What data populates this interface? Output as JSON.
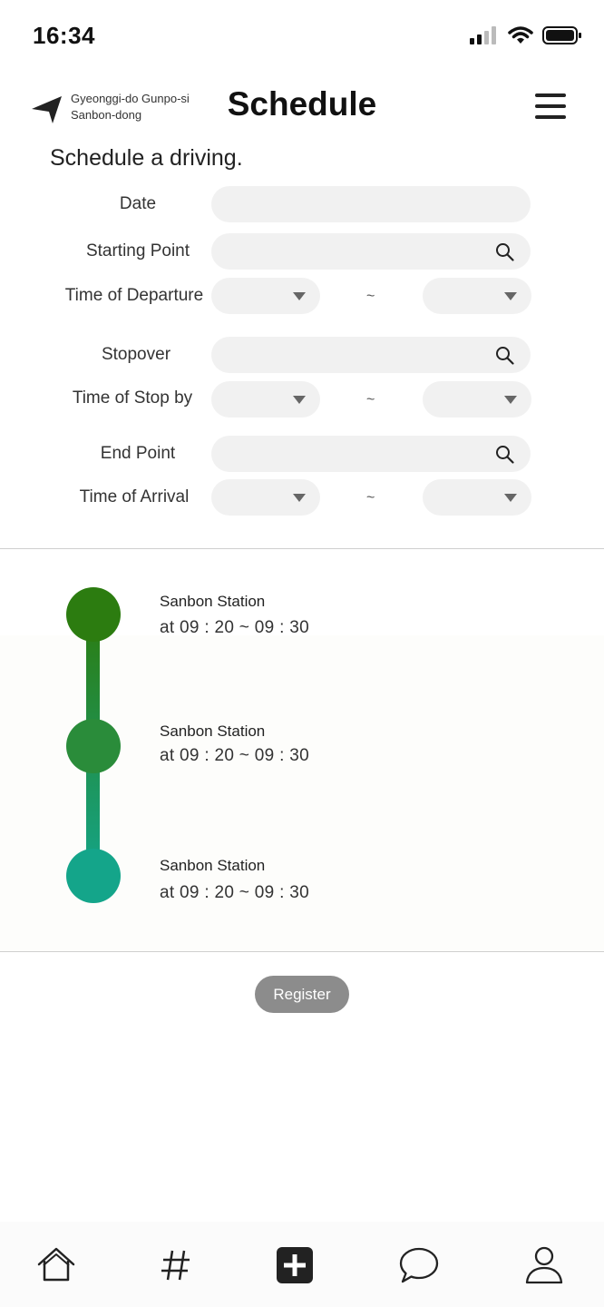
{
  "status_bar": {
    "time": "16:34"
  },
  "header": {
    "location_line1": "Gyeonggi-do Gunpo-si",
    "location_line2": "Sanbon-dong",
    "title": "Schedule"
  },
  "form": {
    "heading": "Schedule a driving.",
    "date_label": "Date",
    "starting_point_label": "Starting Point",
    "departure_label": "Time of Departure",
    "stopover_label": "Stopover",
    "stop_time_label": "Time of Stop by",
    "end_point_label": "End Point",
    "arrival_label": "Time of Arrival",
    "range_separator": "~"
  },
  "timeline": {
    "stops": [
      {
        "name": "Sanbon Station",
        "time": "at  09 : 20  ~  09 : 30"
      },
      {
        "name": "Sanbon Station",
        "time": "at  09 : 20  ~  09 : 30"
      },
      {
        "name": "Sanbon Station",
        "time": "at  09 : 20  ~  09 : 30"
      }
    ],
    "colors": {
      "start": "#2c7c10",
      "middle": "#2a8c3a",
      "end": "#14a58a"
    }
  },
  "actions": {
    "register_label": "Register"
  },
  "bottom_nav": {
    "items": [
      "home-icon",
      "hashtag-icon",
      "add-icon",
      "chat-icon",
      "profile-icon"
    ]
  }
}
